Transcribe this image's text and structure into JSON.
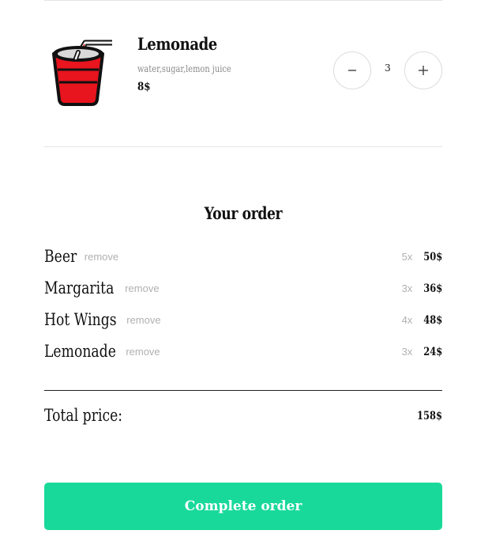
{
  "product": {
    "name": "Lemonade",
    "ingredients": "water,sugar,lemon juice",
    "price": "8$",
    "quantity": "3",
    "image_icon": "red-cup-with-straw-icon",
    "decrement_icon": "minus-icon",
    "increment_icon": "plus-icon"
  },
  "order": {
    "title": "Your order",
    "remove_label": "remove",
    "items": [
      {
        "name": "Beer",
        "qty": "5x",
        "price": "50$"
      },
      {
        "name": "Margarita",
        "qty": "3x",
        "price": "36$"
      },
      {
        "name": "Hot Wings",
        "qty": "4x",
        "price": "48$"
      },
      {
        "name": "Lemonade",
        "qty": "3x",
        "price": "24$"
      }
    ],
    "total_label": "Total price:",
    "total_value": "158$",
    "complete_label": "Complete order"
  },
  "colors": {
    "accent": "#19d99a",
    "cup_red": "#e8141e",
    "muted_text": "#b0b0b0"
  }
}
